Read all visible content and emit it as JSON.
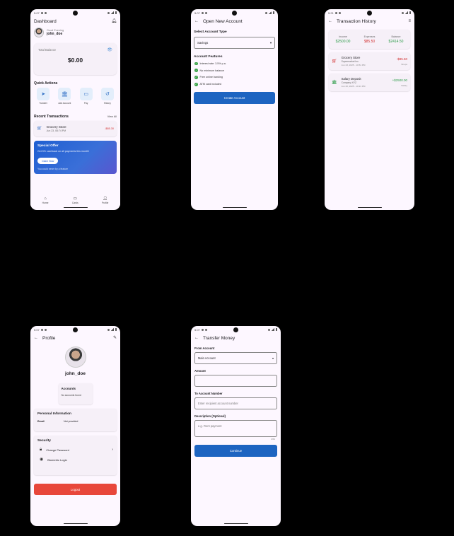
{
  "status": {
    "time": "5:07",
    "time_history": "5:21"
  },
  "dashboard": {
    "title": "Dashboard",
    "greeting": "Good Evening",
    "username": "john_doe",
    "balance_label": "Total Balance",
    "balance_value": "$0.00",
    "quick_actions_title": "Quick Actions",
    "quick_actions": [
      {
        "label": "Transfer",
        "icon": "send-icon"
      },
      {
        "label": "Add Account",
        "icon": "bank-icon"
      },
      {
        "label": "Pay",
        "icon": "card-icon"
      },
      {
        "label": "History",
        "icon": "history-icon"
      }
    ],
    "recent_title": "Recent Transactions",
    "view_all": "View All",
    "recent_txn": {
      "name": "Grocery Store",
      "date": "Jun 23, 08:74 PM",
      "amount": "-$85.30"
    },
    "offer": {
      "title": "Special Offer",
      "desc": "Get 5% cashback on all payments this month!",
      "button": "Claim Now",
      "fine": "You could never by a feature"
    },
    "nav": [
      {
        "label": "Home",
        "icon": "home-icon"
      },
      {
        "label": "Cards",
        "icon": "card-icon"
      },
      {
        "label": "Profile",
        "icon": "person-icon"
      }
    ]
  },
  "open_account": {
    "title": "Open New Account",
    "type_label": "Select Account Type",
    "type_value": "Savings",
    "features_title": "Account Features",
    "features": [
      "Interest rate: 3.5% p.a.",
      "No minimum balance",
      "Free online banking",
      "ATM card included"
    ],
    "button": "Create Account"
  },
  "history": {
    "title": "Transaction History",
    "summary": [
      {
        "label": "Income",
        "value": "$2500.00",
        "color": "#2e9d4a"
      },
      {
        "label": "Expenses",
        "value": "$85.50",
        "color": "#d32f2f"
      },
      {
        "label": "Balance",
        "value": "$2414.50",
        "color": "#2e9d4a"
      }
    ],
    "items": [
      {
        "name": "Grocery Store",
        "sub": "Supermarket Inc.",
        "date": "Jun 23, 2025 - 10:51 PM",
        "amount": "-$85.50",
        "category": "Shops",
        "color": "#d32f2f",
        "icon": "cart-icon"
      },
      {
        "name": "Salary Deposit",
        "sub": "Company XYZ",
        "date": "Jun 20, 2025 - 10:21 PM",
        "amount": "+$2500.00",
        "category": "Salary",
        "color": "#2e9d4a",
        "icon": "bank-icon"
      }
    ]
  },
  "profile": {
    "title": "Profile",
    "username": "john_doe",
    "accounts_title": "Accounts",
    "accounts_empty": "No accounts found",
    "personal_title": "Personal Information",
    "email_label": "Email",
    "email_value": "Not provided",
    "security_title": "Security",
    "change_password": "Change Password",
    "biometric": "Biometric Login",
    "logout": "Logout"
  },
  "transfer": {
    "title": "Transfer Money",
    "from_label": "From Account",
    "from_value": "Main Account",
    "amount_label": "Amount",
    "to_label": "To Account Number",
    "to_placeholder": "Enter recipient account number",
    "desc_label": "Description (Optional)",
    "desc_placeholder": "e.g. Rent payment",
    "counter": "0/50",
    "button": "Continue"
  }
}
